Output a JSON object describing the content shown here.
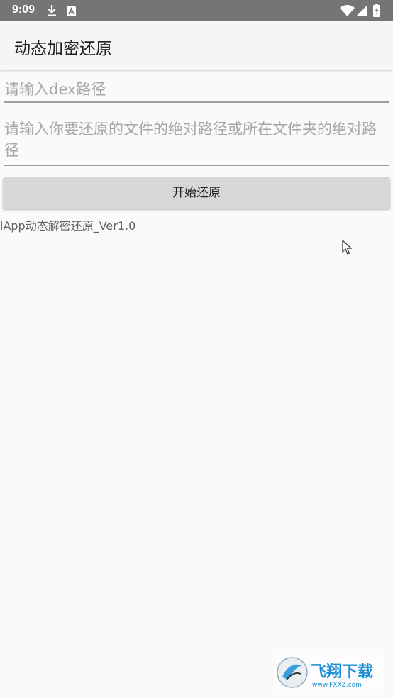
{
  "status_bar": {
    "time": "9:09",
    "icons": [
      "download-icon",
      "keyboard-a-icon",
      "wifi-icon",
      "signal-icon",
      "battery-charging-icon"
    ]
  },
  "app_bar": {
    "title": "动态加密还原"
  },
  "form": {
    "dex_path_placeholder": "请输入dex路径",
    "target_path_placeholder": "请输入你要还原的文件的绝对路径或所在文件夹的绝对路径",
    "start_button_label": "开始还原"
  },
  "footer": {
    "version_text": "iApp动态解密还原_Ver1.0"
  },
  "watermark": {
    "brand": "飞翔下载",
    "site": "www.FXXZ.com"
  },
  "colors": {
    "status_bar": "#757575",
    "app_bar": "#f5f5f5",
    "background": "#fafafa",
    "button": "#d7d7d7",
    "hint_text": "#a6a6a6"
  }
}
